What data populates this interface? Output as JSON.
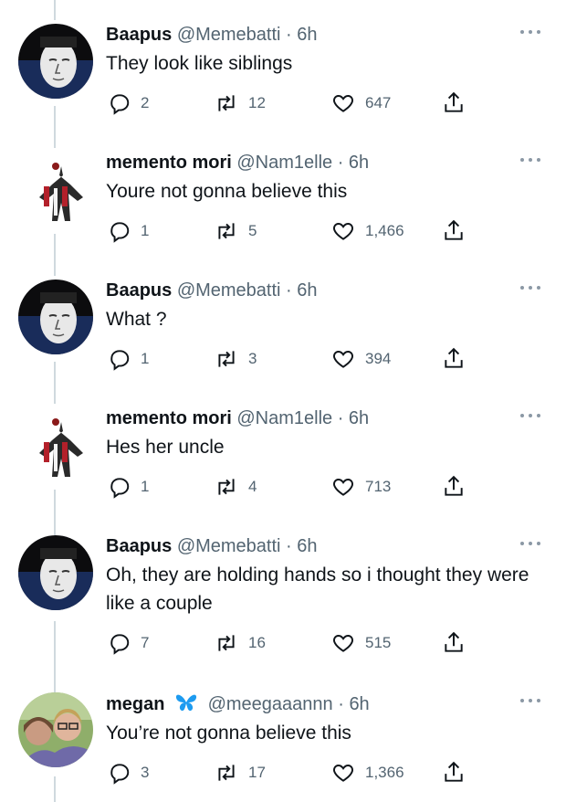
{
  "tweets": [
    {
      "name": "Baapus",
      "handle": "@Memebatti · 6h",
      "text": "They look like siblings",
      "replies": "2",
      "retweets": "12",
      "likes": "647",
      "avatar": "wojak-avatar"
    },
    {
      "name": "memento mori",
      "handle": "@Nam1elle · 6h",
      "text": "Youre not gonna believe this",
      "replies": "1",
      "retweets": "5",
      "likes": "1,466",
      "avatar": "hooded-figure-avatar"
    },
    {
      "name": "Baapus",
      "handle": "@Memebatti · 6h",
      "text": "What ?",
      "replies": "1",
      "retweets": "3",
      "likes": "394",
      "avatar": "wojak-avatar"
    },
    {
      "name": "memento mori",
      "handle": "@Nam1elle · 6h",
      "text": "Hes her uncle",
      "replies": "1",
      "retweets": "4",
      "likes": "713",
      "avatar": "hooded-figure-avatar"
    },
    {
      "name": "Baapus",
      "handle": "@Memebatti · 6h",
      "text": "Oh, they are holding hands so i thought they were like a couple",
      "replies": "7",
      "retweets": "16",
      "likes": "515",
      "avatar": "wojak-avatar"
    },
    {
      "name": "megan",
      "name_emoji": "butterfly-icon",
      "handle": "@meegaaannn · 6h",
      "text": "You’re not gonna believe this",
      "replies": "3",
      "retweets": "17",
      "likes": "1,366",
      "avatar": "photo-avatar"
    }
  ],
  "colors": {
    "text": "#0f1419",
    "muted": "#536471",
    "thread_line": "#cfd9de",
    "butterfly": "#1d9bf0"
  }
}
